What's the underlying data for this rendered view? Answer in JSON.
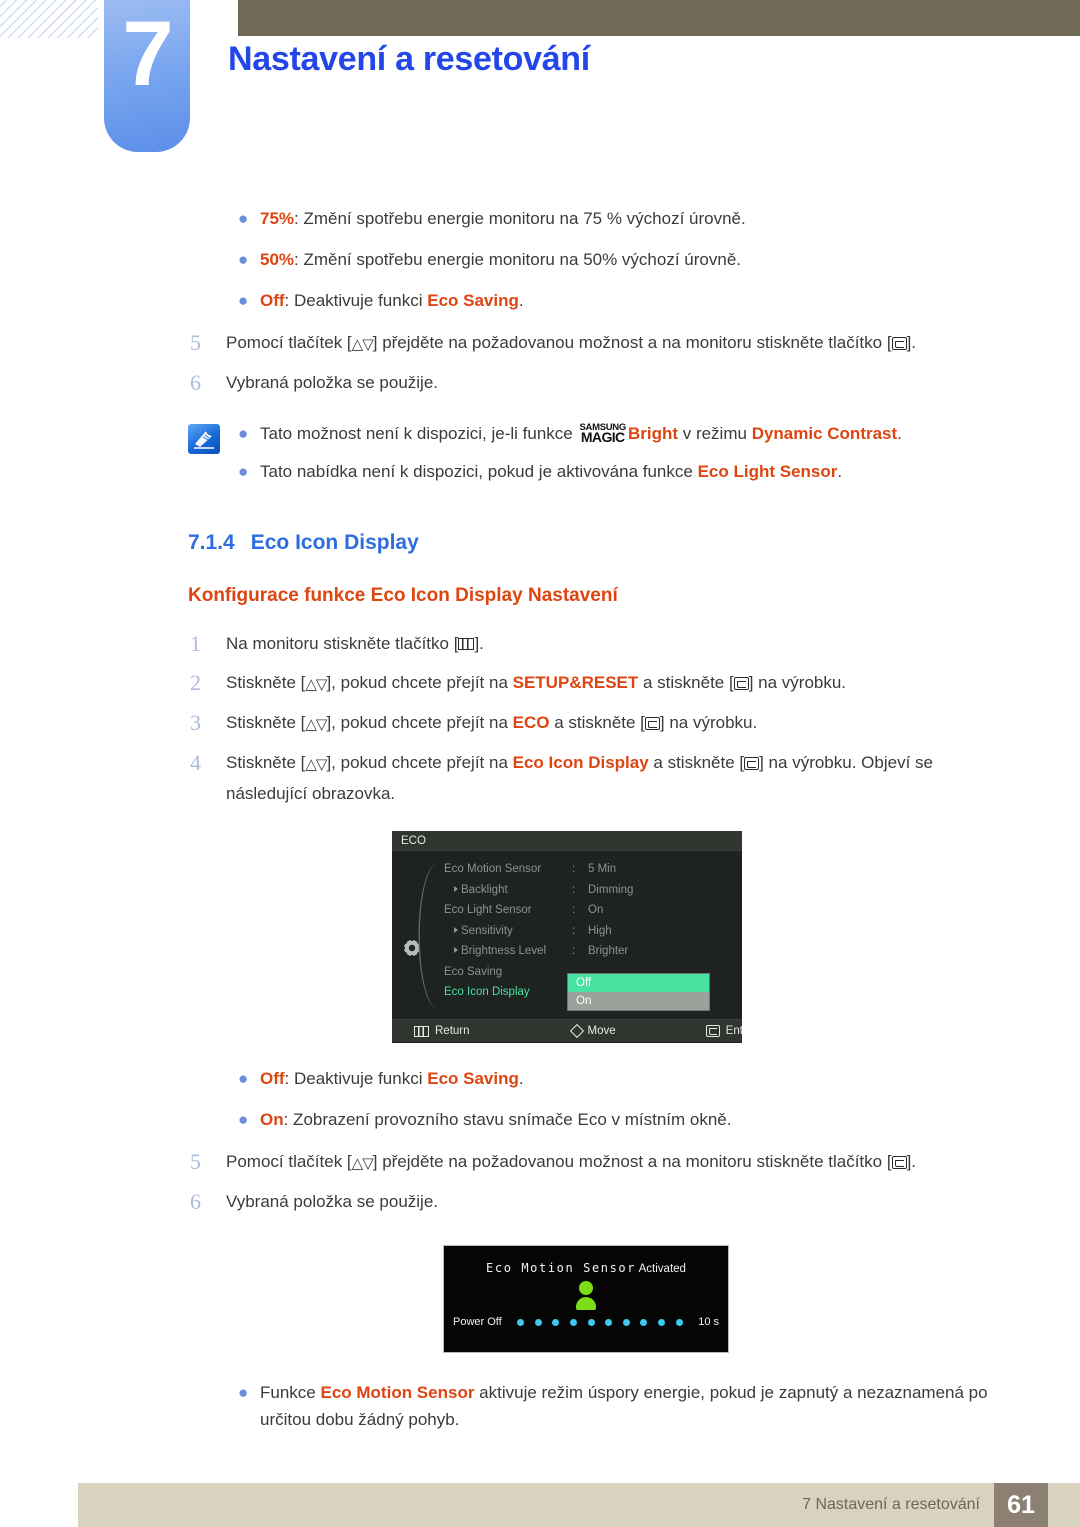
{
  "header": {
    "chapter_number": "7",
    "chapter_title": "Nastavení a resetování"
  },
  "intro_bullets": [
    {
      "term": "75%",
      "rest": ": Změní spotřebu energie monitoru na 75 % výchozí úrovně."
    },
    {
      "term": "50%",
      "rest": ": Změní spotřebu energie monitoru na 50% výchozí úrovně."
    },
    {
      "term": "Off",
      "rest_pre": ": Deaktivuje funkci ",
      "rest_hl": "Eco Saving",
      "rest_post": "."
    }
  ],
  "intro_steps": [
    {
      "num": "5",
      "pre": "Pomocí tlačítek [",
      "key1": "updown",
      "mid": "] přejděte na požadovanou možnost a na monitoru stiskněte tlačítko [",
      "key2": "enter",
      "post": "]."
    },
    {
      "num": "6",
      "pre": "Vybraná položka se použije.",
      "key1": "",
      "mid": "",
      "key2": "",
      "post": ""
    }
  ],
  "note": {
    "icon": "note-pencil-icon",
    "line1_pre": "Tato možnost není k dispozici, je-li funkce ",
    "logo_top": "SAMSUNG",
    "logo_bottom": "MAGIC",
    "line1_hl1": "Bright",
    "line1_mid": " v režimu ",
    "line1_hl2": "Dynamic Contrast",
    "line1_post": ".",
    "line2_pre": "Tato nabídka není k dispozici, pokud je aktivována funkce ",
    "line2_hl": "Eco Light Sensor",
    "line2_post": "."
  },
  "section": {
    "number": "7.1.4",
    "title": "Eco Icon Display",
    "subtitle": "Konfigurace funkce Eco Icon Display Nastavení"
  },
  "steps": [
    {
      "num": "1",
      "pre": "Na monitoru stiskněte tlačítko [",
      "key1": "menu",
      "post": "]."
    },
    {
      "num": "2",
      "pre": "Stiskněte [",
      "key1": "updown",
      "mid": "], pokud chcete přejít na ",
      "hl": "SETUP&RESET",
      "mid2": " a stiskněte [",
      "key2": "enter",
      "post": "] na výrobku."
    },
    {
      "num": "3",
      "pre": "Stiskněte [",
      "key1": "updown",
      "mid": "], pokud chcete přejít na ",
      "hl": "ECO",
      "mid2": " a stiskněte [",
      "key2": "enter",
      "post": "] na výrobku."
    },
    {
      "num": "4",
      "pre": "Stiskněte [",
      "key1": "updown",
      "mid": "], pokud chcete přejít na ",
      "hl": "Eco Icon Display",
      "mid2": " a stiskněte [",
      "key2": "enter",
      "post": "] na výrobku. Objeví se následující obrazovka."
    }
  ],
  "osd": {
    "title": "ECO",
    "gear_icon": "gear-icon",
    "rows": [
      {
        "label": "Eco Motion Sensor",
        "sub": false,
        "value": "5 Min",
        "active": false
      },
      {
        "label": "Backlight",
        "sub": true,
        "value": "Dimming",
        "active": false
      },
      {
        "label": "Eco Light Sensor",
        "sub": false,
        "value": "On",
        "active": false
      },
      {
        "label": "Sensitivity",
        "sub": true,
        "value": "High",
        "active": false
      },
      {
        "label": "Brightness Level",
        "sub": true,
        "value": "Brighter",
        "active": false
      },
      {
        "label": "Eco Saving",
        "sub": false,
        "value": "",
        "active": false
      },
      {
        "label": "Eco Icon Display",
        "sub": false,
        "value": "",
        "active": true
      }
    ],
    "dropdown": {
      "selected": "Off",
      "unselected": "On"
    },
    "footer": [
      {
        "icon": "menu-icon",
        "label": "Return"
      },
      {
        "icon": "diamond-move-icon",
        "label": "Move"
      },
      {
        "icon": "enter-icon",
        "label": "Enter"
      }
    ]
  },
  "post_bullets": [
    {
      "term": "Off",
      "rest_pre": ": Deaktivuje funkci ",
      "rest_hl": "Eco Saving",
      "rest_post": "."
    },
    {
      "term": "On",
      "rest_pre": ": Zobrazení provozního stavu snímače Eco v místním okně.",
      "rest_hl": "",
      "rest_post": ""
    }
  ],
  "post_steps": [
    {
      "num": "5",
      "pre": "Pomocí tlačítek [",
      "key1": "updown",
      "mid": "] přejděte na požadovanou možnost a na monitoru stiskněte tlačítko [",
      "key2": "enter",
      "post": "]."
    },
    {
      "num": "6",
      "pre": "Vybraná položka se použije.",
      "key1": "",
      "mid": "",
      "key2": "",
      "post": ""
    }
  ],
  "motion_popup": {
    "title_main": "Eco Motion Sensor",
    "title_suffix": " Activated",
    "person_icon": "person-icon",
    "power_label": "Power Off",
    "dot_count": 10,
    "time": "10 s"
  },
  "final_bullet": {
    "pre": "Funkce ",
    "hl": "Eco Motion Sensor",
    "post": " aktivuje režim úspory energie, pokud je zapnutý a nezaznamená po určitou dobu žádný pohyb."
  },
  "footer": {
    "text": "7 Nastavení a resetování",
    "page": "61"
  },
  "colors": {
    "accent_blue": "#2346e8",
    "heading_blue": "#2d6de0",
    "highlight_orange": "#dd4511",
    "header_bar": "#6e6a55",
    "footer_bar": "#d8d2bf",
    "page_box": "#8c8073",
    "osd_green": "#48e3a0",
    "popup_green": "#7ddc18",
    "popup_cyan": "#3fc8f0"
  }
}
